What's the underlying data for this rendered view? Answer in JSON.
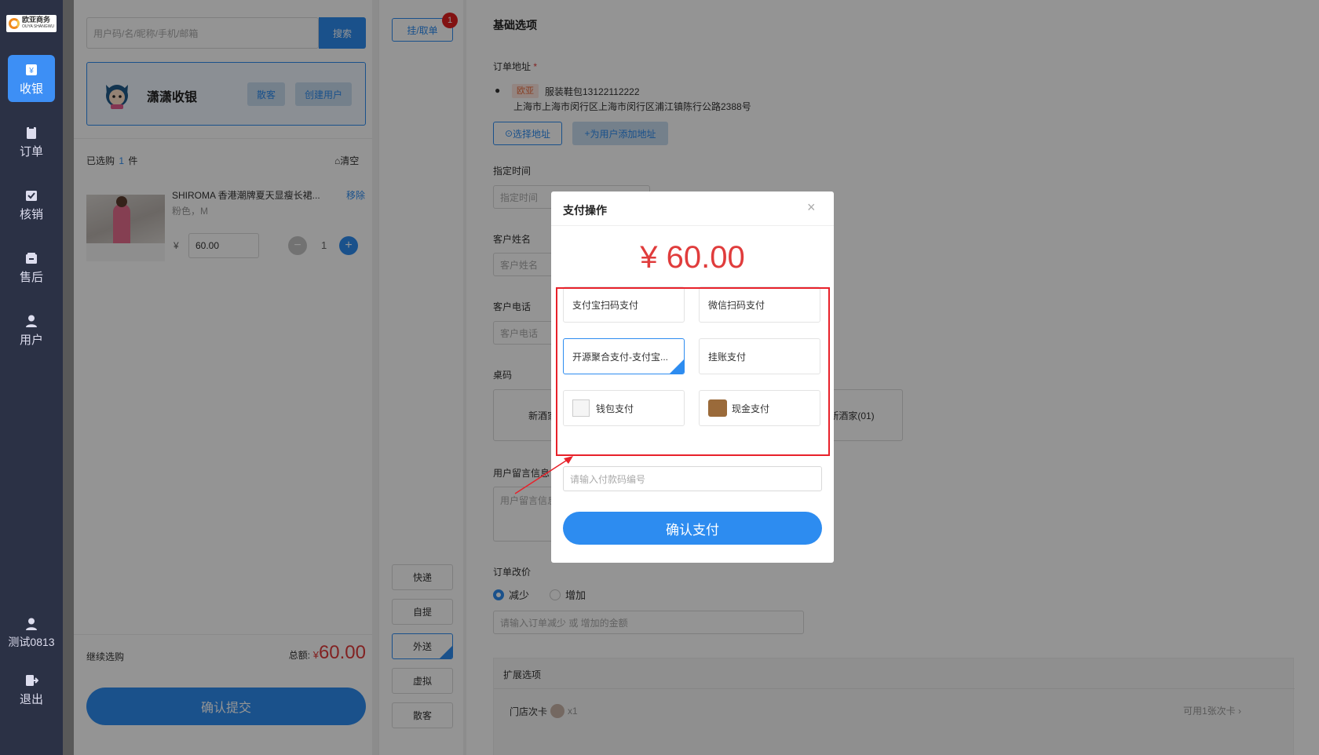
{
  "sidebar": {
    "logo": {
      "main": "欧亚商务",
      "sub": "OUYA SHANGWU"
    },
    "nav": [
      {
        "label": "收银",
        "icon": "cashier-icon"
      },
      {
        "label": "订单",
        "icon": "order-icon"
      },
      {
        "label": "核销",
        "icon": "verify-icon"
      },
      {
        "label": "售后",
        "icon": "aftersale-icon"
      },
      {
        "label": "用户",
        "icon": "user-icon"
      }
    ],
    "account": "测试0813",
    "logout": "退出"
  },
  "left": {
    "search_placeholder": "用户码/名/昵称/手机/邮箱",
    "search_button": "搜索",
    "shop_name": "潇潇收银",
    "guest_button": "散客",
    "create_user_button": "创建用户",
    "selected_prefix": "已选购",
    "selected_count": "1",
    "selected_suffix": "件",
    "clear": "清空",
    "product": {
      "title": "SHIROMA 香港潮牌夏天显瘦长裙...",
      "spec": "粉色，M",
      "remove": "移除",
      "currency": "¥",
      "price": "60.00",
      "qty": "1"
    },
    "continue": "继续选购",
    "total_label": "总额:",
    "total_currency": "¥",
    "total": "60.00",
    "submit": "确认提交"
  },
  "middle": {
    "hang_button": "挂/取单",
    "hang_badge": "1",
    "delivery": [
      "快递",
      "自提",
      "外送",
      "虚拟",
      "散客"
    ],
    "selected_delivery": "外送"
  },
  "right": {
    "section_title": "基础选项",
    "address_label": "订单地址",
    "address_tag": "欧亚",
    "address_contact": "服装鞋包13122112222",
    "address_detail": "上海市上海市闵行区上海市闵行区浦江镇陈行公路2388号",
    "select_address": "选择地址",
    "add_address": "为用户添加地址",
    "time_label": "指定时间",
    "time_placeholder": "指定时间",
    "name_label": "客户姓名",
    "name_placeholder": "客户姓名",
    "phone_label": "客户电话",
    "phone_placeholder": "客户电话",
    "table_label": "桌码",
    "table_left": "新酒家(",
    "table_right": "新酒家(01)",
    "message_label": "用户留言信息",
    "message_placeholder": "用户留言信息",
    "price_change_label": "订单改价",
    "radio_decrease": "减少",
    "radio_increase": "增加",
    "price_change_placeholder": "请输入订单减少 或 增加的金额",
    "ext_title": "扩展选项",
    "store_card": "门店次卡",
    "store_card_qty": "x1",
    "card_available": "可用1张次卡"
  },
  "modal": {
    "title": "支付操作",
    "amount": "¥ 60.00",
    "options": [
      {
        "label": "支付宝扫码支付",
        "icon": ""
      },
      {
        "label": "微信扫码支付",
        "icon": ""
      },
      {
        "label": "开源聚合支付-支付宝...",
        "icon": ""
      },
      {
        "label": "挂账支付",
        "icon": ""
      },
      {
        "label": "钱包支付",
        "icon": "wallet-image-icon"
      },
      {
        "label": "现金支付",
        "icon": "cash-icon"
      }
    ],
    "selected_option": "开源聚合支付-支付宝...",
    "code_placeholder": "请输入付款码编号",
    "confirm": "确认支付"
  },
  "colors": {
    "accent": "#2d8cf0",
    "price": "#e03c3c",
    "sidebar": "#2b3145",
    "annotation": "#e8212a"
  }
}
